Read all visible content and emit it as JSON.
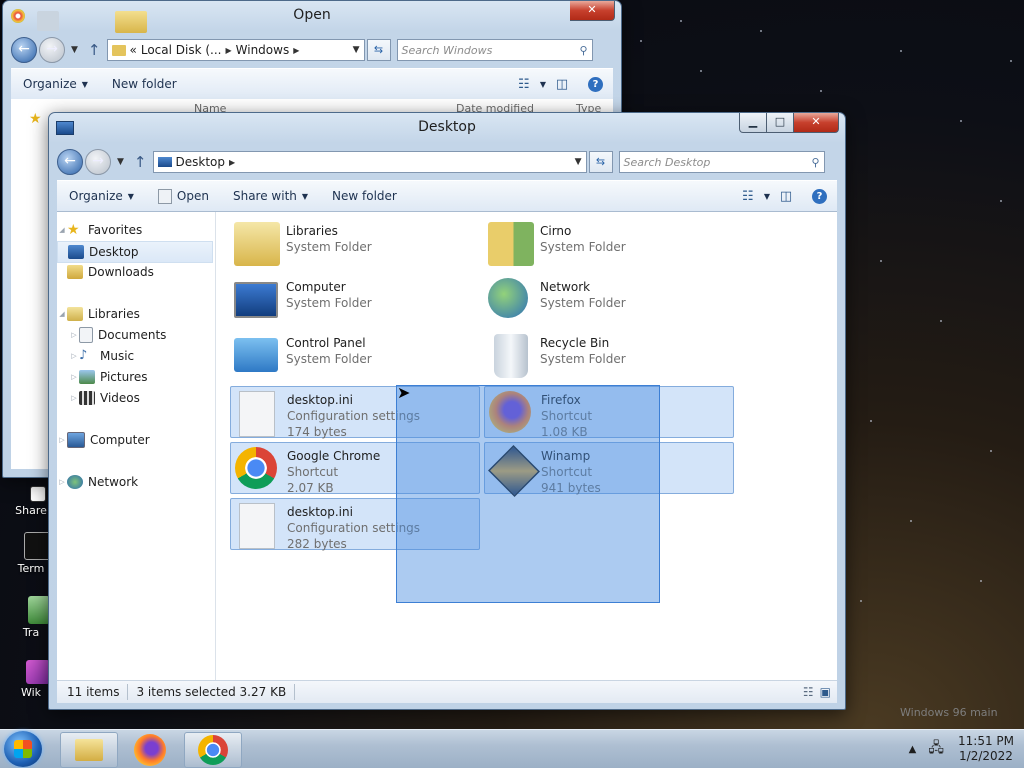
{
  "back_window": {
    "title": "Open",
    "address": {
      "prefix": "«",
      "segments": [
        "Local Disk (...",
        "Windows"
      ]
    },
    "search_placeholder": "Search Windows",
    "commands": {
      "organize": "Organize",
      "new_folder": "New folder"
    },
    "columns": [
      "Name",
      "Date modified",
      "Type"
    ]
  },
  "front_window": {
    "title": "Desktop",
    "address": {
      "segments": [
        "Desktop"
      ]
    },
    "search_placeholder": "Search Desktop",
    "commands": {
      "organize": "Organize",
      "open": "Open",
      "share_with": "Share with",
      "new_folder": "New folder"
    },
    "nav": {
      "favorites": "Favorites",
      "desktop": "Desktop",
      "downloads": "Downloads",
      "libraries": "Libraries",
      "documents": "Documents",
      "music": "Music",
      "pictures": "Pictures",
      "videos": "Videos",
      "computer": "Computer",
      "network": "Network"
    },
    "items": [
      {
        "name": "Libraries",
        "type": "System Folder",
        "size": ""
      },
      {
        "name": "Cirno",
        "type": "System Folder",
        "size": ""
      },
      {
        "name": "Computer",
        "type": "System Folder",
        "size": ""
      },
      {
        "name": "Network",
        "type": "System Folder",
        "size": ""
      },
      {
        "name": "Control Panel",
        "type": "System Folder",
        "size": ""
      },
      {
        "name": "Recycle Bin",
        "type": "System Folder",
        "size": ""
      },
      {
        "name": "desktop.ini",
        "type": "Configuration settings",
        "size": "174 bytes"
      },
      {
        "name": "Firefox",
        "type": "Shortcut",
        "size": "1.08 KB"
      },
      {
        "name": "Google Chrome",
        "type": "Shortcut",
        "size": "2.07 KB"
      },
      {
        "name": "Winamp",
        "type": "Shortcut",
        "size": "941 bytes"
      },
      {
        "name": "desktop.ini",
        "type": "Configuration settings",
        "size": "282 bytes"
      }
    ],
    "status": {
      "count": "11 items",
      "selected": "3 items selected  3.27 KB"
    }
  },
  "desktop_icons": [
    "Share",
    "Term",
    "Tra",
    "Wik"
  ],
  "taskbar": {
    "time": "11:51 PM",
    "date": "1/2/2022"
  },
  "watermark": "Windows 96 main",
  "colors": {
    "selection": "#aecef4",
    "marquee": "#468ce1",
    "accent": "#2f6fbf"
  }
}
